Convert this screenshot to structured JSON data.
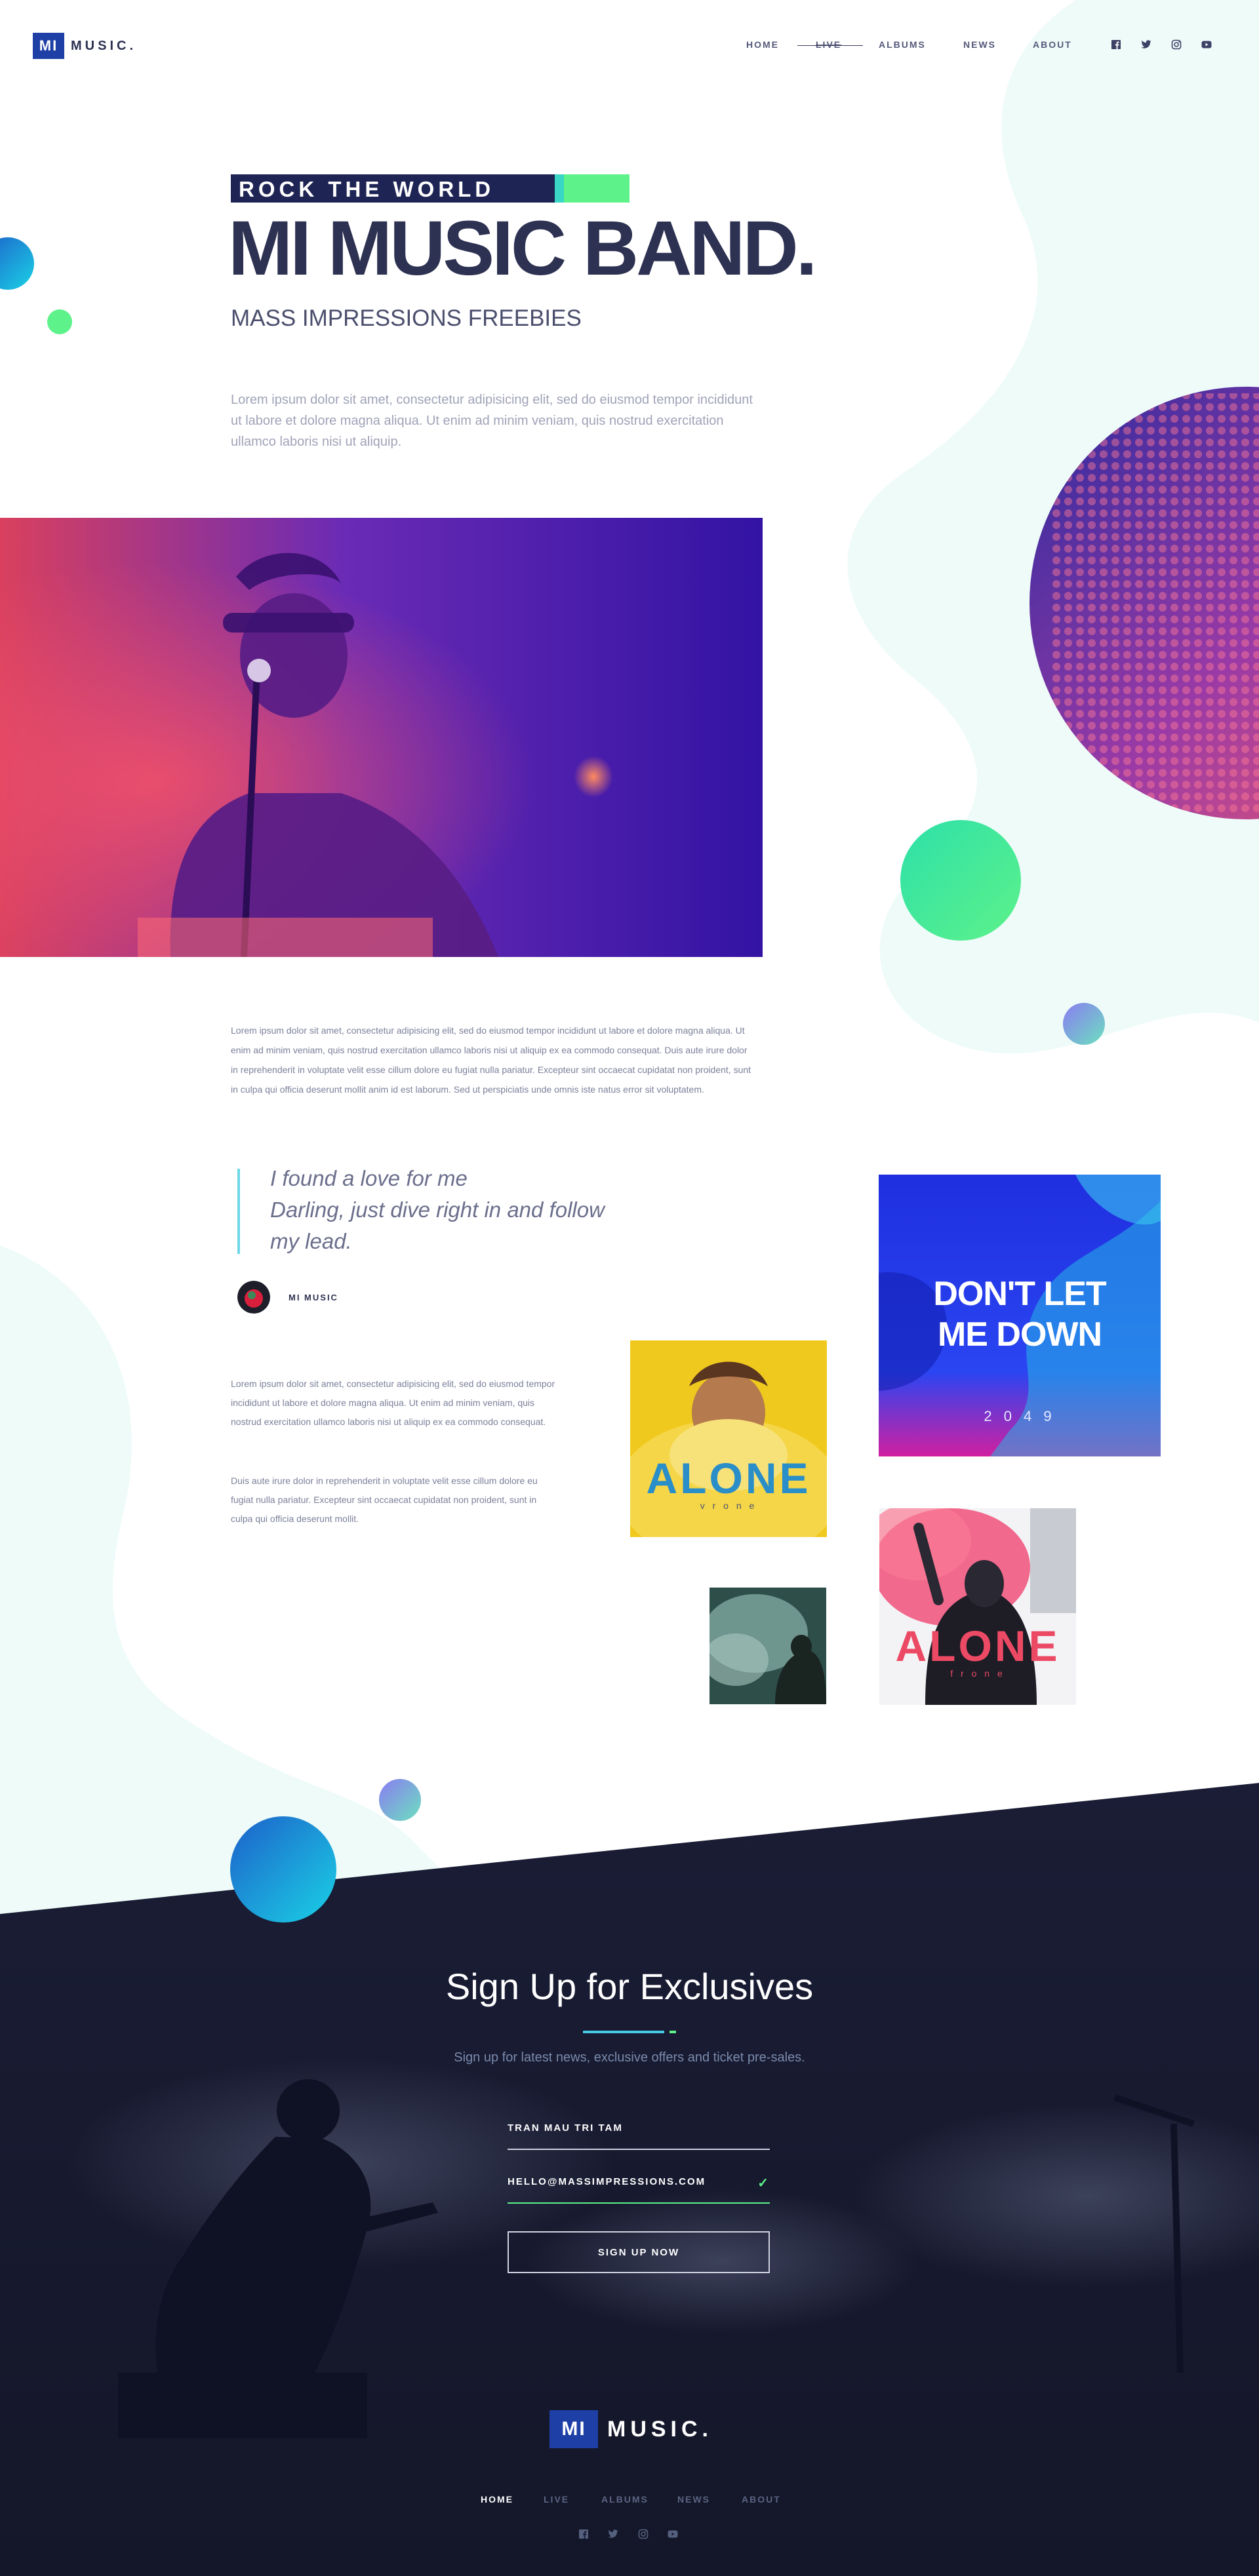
{
  "header": {
    "logo_box": "MI",
    "logo_text": "MUSIC.",
    "nav": [
      {
        "label": "HOME",
        "state": "normal"
      },
      {
        "label": "LIVE",
        "state": "strikethrough"
      },
      {
        "label": "ALBUMS",
        "state": "normal"
      },
      {
        "label": "NEWS",
        "state": "normal"
      },
      {
        "label": "ABOUT",
        "state": "normal"
      }
    ],
    "social_icons": [
      "facebook-icon",
      "twitter-icon",
      "instagram-icon",
      "youtube-icon"
    ]
  },
  "hero": {
    "tag": "ROCK THE WORLD",
    "title": "MI MUSIC BAND.",
    "subtitle": "MASS IMPRESSIONS FREEBIES",
    "paragraph": "Lorem ipsum dolor sit amet, consectetur adipisicing elit, sed do eiusmod tempor incididunt ut labore et dolore magna aliqua. Ut enim ad minim veniam, quis nostrud exercitation ullamco laboris nisi ut aliquip."
  },
  "content": {
    "paragraph_main": "Lorem ipsum dolor sit amet, consectetur adipisicing elit, sed do eiusmod tempor incididunt ut labore et dolore magna aliqua. Ut enim ad minim veniam, quis nostrud exercitation ullamco laboris nisi ut aliquip ex ea commodo consequat. Duis aute irure dolor in reprehenderit in voluptate velit esse cillum dolore eu fugiat nulla pariatur. Excepteur sint occaecat cupidatat non proident, sunt in culpa qui officia deserunt mollit anim id est laborum. Sed ut perspiciatis unde omnis iste natus error sit voluptatem.",
    "quote_lines": [
      "I found a love for me",
      "Darling, just dive right in and follow",
      "my lead."
    ],
    "author": "MI MUSIC",
    "paragraph_a": "Lorem ipsum dolor sit amet, consectetur adipisicing elit, sed do eiusmod tempor incididunt ut labore et dolore magna aliqua. Ut enim ad minim veniam, quis nostrud exercitation ullamco laboris nisi ut aliquip ex ea commodo consequat.",
    "paragraph_b": "Duis aute irure dolor in reprehenderit in voluptate velit esse cillum dolore eu fugiat nulla pariatur. Excepteur sint occaecat cupidatat non proident, sunt in culpa qui officia deserunt mollit."
  },
  "albums": {
    "dont_let": {
      "line1": "DON'T LET",
      "line2": "ME DOWN",
      "year": "2 0 4 9"
    },
    "alone_yellow": {
      "title": "ALONE",
      "sub": "v r o n e"
    },
    "alone_red": {
      "title": "ALONE",
      "sub": "f r o n e"
    }
  },
  "signup": {
    "title": "Sign Up for Exclusives",
    "subtitle": "Sign up for latest news, exclusive offers and ticket pre-sales.",
    "name_value": "TRAN MAU TRI TAM",
    "email_value": "HELLO@MASSIMPRESSIONS.COM",
    "button": "SIGN UP NOW"
  },
  "footer": {
    "logo_box": "MI",
    "logo_text": "MUSIC.",
    "nav": [
      {
        "label": "HOME",
        "active": true
      },
      {
        "label": "LIVE",
        "active": false
      },
      {
        "label": "ALBUMS",
        "active": false
      },
      {
        "label": "NEWS",
        "active": false
      },
      {
        "label": "ABOUT",
        "active": false
      }
    ],
    "social_icons": [
      "facebook-icon",
      "twitter-icon",
      "instagram-icon",
      "youtube-icon"
    ]
  },
  "colors": {
    "brand_blue": "#1d3fa6",
    "navy": "#1e2454",
    "accent_green": "#5df28a",
    "accent_cyan": "#47c9e6",
    "footer_bg": "#191c33"
  }
}
